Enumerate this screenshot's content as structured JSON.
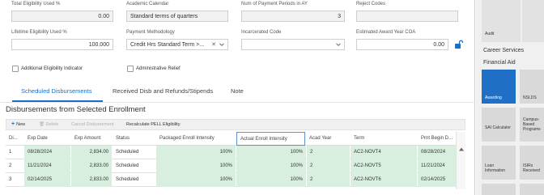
{
  "fields": {
    "total_elig_label": "Total Eligibility Used %",
    "total_elig_value": "0.00",
    "academic_calendar_label": "Academic Calendar",
    "academic_calendar_value": "Standard terms of quarters",
    "num_periods_label": "Num of Payment Periods in AY",
    "num_periods_value": "3",
    "reject_codes_label": "Reject Codes",
    "reject_codes_value": "",
    "lifetime_elig_label": "Lifetime Eligibility Used %",
    "lifetime_elig_value": "100.000",
    "payment_method_label": "Payment Methodology",
    "payment_method_value": "Credit Hrs Standard Term >...",
    "incarcerated_label": "Incarcerated Code",
    "incarcerated_value": "",
    "award_coa_label": "Estimated Award Year COA",
    "award_coa_value": "0.00",
    "additional_elig_label": "Additional Eligibility Indicator",
    "admin_relief_label": "Administrative Relief"
  },
  "tabs": [
    {
      "label": "Scheduled Disbursements",
      "active": true
    },
    {
      "label": "Received Disb and Refunds/Stipends",
      "active": false
    },
    {
      "label": "Note",
      "active": false
    }
  ],
  "section_title": "Disbursements from Selected Enrollment",
  "toolbar": {
    "new": "New",
    "delete": "Delete",
    "cancel": "Cancel Disbursement",
    "recalc": "Recalculate PELL Eligibility"
  },
  "table": {
    "columns": [
      "Di...",
      "Exp Date",
      "Exp Amount",
      "Status",
      "Packaged Enroll Intensity",
      "Actual Enroll Intensity",
      "Acad Year",
      "Term",
      "Prnt Begin D..."
    ],
    "rows": [
      [
        "1",
        "08/28/2024",
        "2,834.00",
        "Scheduled",
        "100%",
        "100%",
        "2",
        "AC2-NOVT4",
        "08/28/2024"
      ],
      [
        "2",
        "11/21/2024",
        "2,833.00",
        "Scheduled",
        "100%",
        "100%",
        "2",
        "AC2-NOVT5",
        "11/21/2024"
      ],
      [
        "3",
        "02/14/2025",
        "2,833.00",
        "Scheduled",
        "100%",
        "100%",
        "2",
        "AC2-NOVT6",
        "02/14/2025"
      ]
    ]
  },
  "right_panel": {
    "audit": "Audit",
    "career_services": "Career Services",
    "financial_aid": "Financial Aid",
    "tiles": [
      "Awarding",
      "NSLDS",
      "SAI Calculator",
      "Campus-Based Programs",
      "Loan Information",
      "ISIRs Received"
    ]
  },
  "colors": {
    "accent": "#1a6fc4",
    "tile_active": "#1f6fc6",
    "tile": "#d9d9d9",
    "green_cell": "#d8efdf"
  }
}
